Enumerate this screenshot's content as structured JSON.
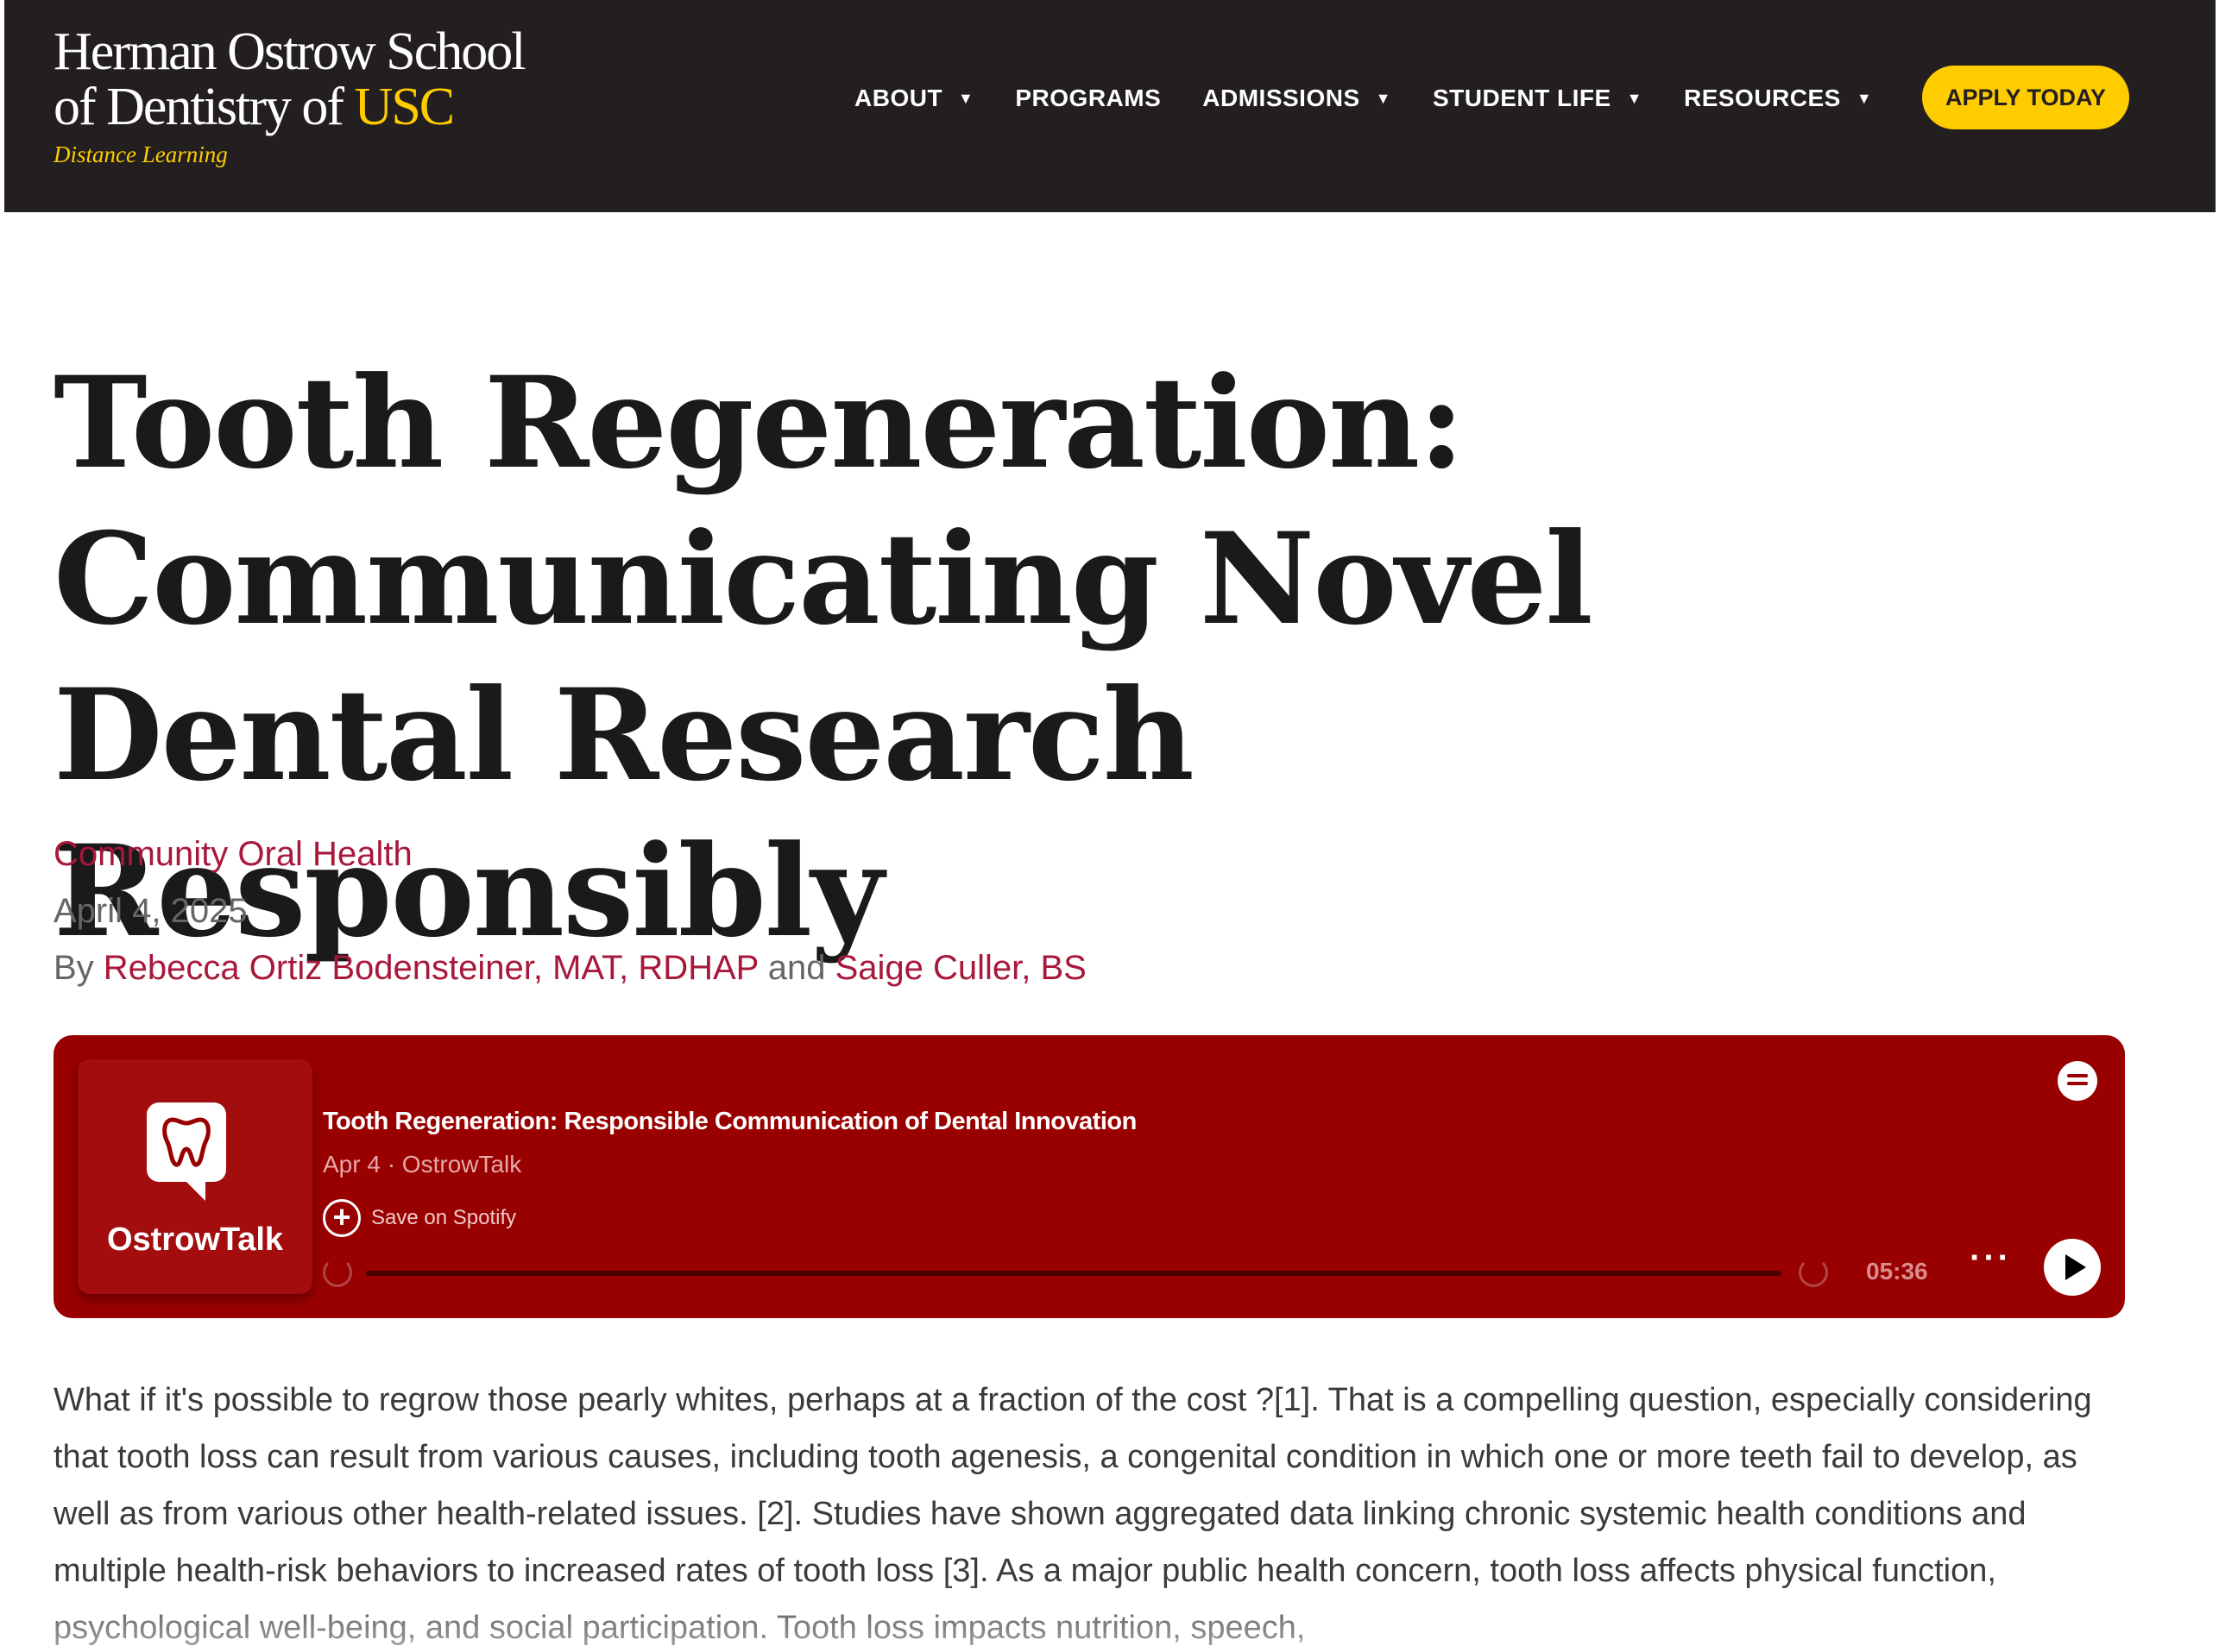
{
  "header": {
    "logo": {
      "line1": "Herman Ostrow School",
      "line2_prefix": "of Dentistry of ",
      "line2_brand": "USC",
      "subtitle": "Distance Learning"
    },
    "nav": [
      {
        "label": "ABOUT",
        "has_dropdown": true
      },
      {
        "label": "PROGRAMS",
        "has_dropdown": false
      },
      {
        "label": "ADMISSIONS",
        "has_dropdown": true
      },
      {
        "label": "STUDENT LIFE",
        "has_dropdown": true
      },
      {
        "label": "RESOURCES",
        "has_dropdown": true
      }
    ],
    "cta_label": "APPLY TODAY",
    "colors": {
      "background": "#231f20",
      "accent": "#ffcc00"
    }
  },
  "article": {
    "title": "Tooth Regeneration: Communicating Novel Dental Research Responsibly",
    "category": "Community Oral Health",
    "date": "April 4, 2025",
    "byline": {
      "prefix": "By ",
      "author1": "Rebecca Ortiz Bodensteiner, MAT, RDHAP",
      "conjunction": " and ",
      "author2": "Saige Culler, BS"
    },
    "body": "What if it's possible to regrow those pearly whites, perhaps at a fraction of the cost ?[1]. That is a compelling question, especially considering that tooth loss can result from various causes, including tooth agenesis, a congenital condition in which one or more teeth fail to develop, as well as from various other health-related issues. [2]. Studies have shown aggregated data linking chronic systemic health conditions and multiple health-risk behaviors to increased rates of tooth loss [3]. As a major public health concern, tooth loss affects physical function, psychological well-being, and social participation. Tooth loss impacts nutrition, speech,"
  },
  "player": {
    "show_name": "OstrowTalk",
    "episode_title": "Tooth Regeneration: Responsible Communication of Dental Innovation",
    "episode_meta": "Apr 4 · OstrowTalk",
    "save_label": "Save on Spotify",
    "duration": "05:36",
    "progress": 0,
    "colors": {
      "background": "#990000",
      "accent": "#ffffff"
    },
    "icons": [
      "tooth-icon",
      "spotify-icon",
      "add-circle-icon",
      "rewind-15-icon",
      "forward-15-icon",
      "more-icon",
      "play-icon"
    ]
  }
}
